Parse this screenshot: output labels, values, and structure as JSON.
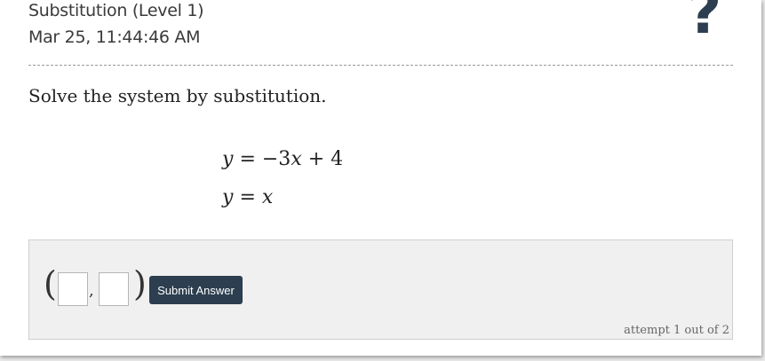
{
  "header": {
    "title": "Substitution (Level 1)",
    "timestamp": "Mar 25, 11:44:46 AM",
    "help_icon": "?"
  },
  "question": {
    "prompt": "Solve the system by substitution.",
    "equation1": {
      "lhs": "y",
      "eq": "=",
      "rhs_prefix": "−3",
      "rhs_var": "x",
      "rhs_suffix": "+ 4"
    },
    "equation2": {
      "lhs": "y",
      "eq": "=",
      "rhs_var": "x"
    }
  },
  "answer": {
    "open_paren": "(",
    "comma": ",",
    "close_paren": ")",
    "submit_label": "Submit Answer",
    "attempt_text": "attempt 1 out of 2",
    "x_value": "",
    "y_value": ""
  },
  "colors": {
    "button_bg": "#2c3e50",
    "help_icon": "#2c3e50",
    "panel_bg": "#f0f0f0"
  }
}
